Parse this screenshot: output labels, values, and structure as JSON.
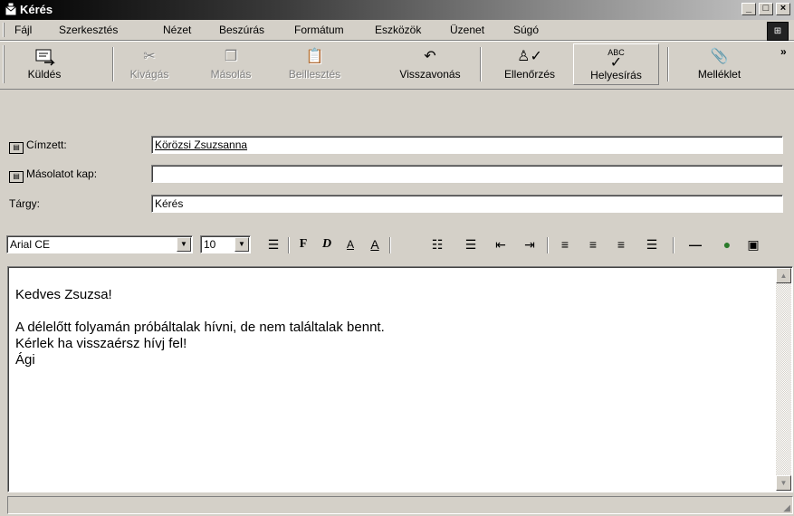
{
  "window": {
    "title": "Kérés",
    "minimize": "_",
    "maximize": "□",
    "close": "×"
  },
  "menu": {
    "items": [
      "Fájl",
      "Szerkesztés",
      "Nézet",
      "Beszúrás",
      "Formátum",
      "Eszközök",
      "Üzenet",
      "Súgó"
    ]
  },
  "toolbar": {
    "buttons": [
      {
        "label": "Küldés",
        "icon": "send-icon",
        "enabled": true
      },
      {
        "label": "Kivágás",
        "icon": "cut-icon",
        "enabled": false
      },
      {
        "label": "Másolás",
        "icon": "copy-icon",
        "enabled": false
      },
      {
        "label": "Beillesztés",
        "icon": "paste-icon",
        "enabled": false
      },
      {
        "label": "Visszavonás",
        "icon": "undo-icon",
        "enabled": true
      },
      {
        "label": "Ellenőrzés",
        "icon": "check-names-icon",
        "enabled": true
      },
      {
        "label": "Helyesírás",
        "icon": "spelling-icon",
        "enabled": true,
        "icon_text": "ABC"
      },
      {
        "label": "Melléklet",
        "icon": "paperclip-icon",
        "enabled": true
      }
    ],
    "overflow": "»"
  },
  "header": {
    "to_label": "Címzett:",
    "to_value": "Körözsi Zsuzsanna",
    "cc_label": "Másolatot kap:",
    "cc_value": "",
    "subject_label": "Tárgy:",
    "subject_value": "Kérés"
  },
  "format": {
    "font": "Arial CE",
    "size": "10"
  },
  "message": {
    "body": "Kedves Zsuzsa!\n\nA délelőtt folyamán próbáltalak hívni, de nem találtalak bennt.\nKérlek ha visszaérsz hívj fel!\nÁgi"
  },
  "colors": {
    "face": "#d4d0c8",
    "title_start": "#000000",
    "title_end": "#c8c8c8",
    "link": "#000000"
  }
}
